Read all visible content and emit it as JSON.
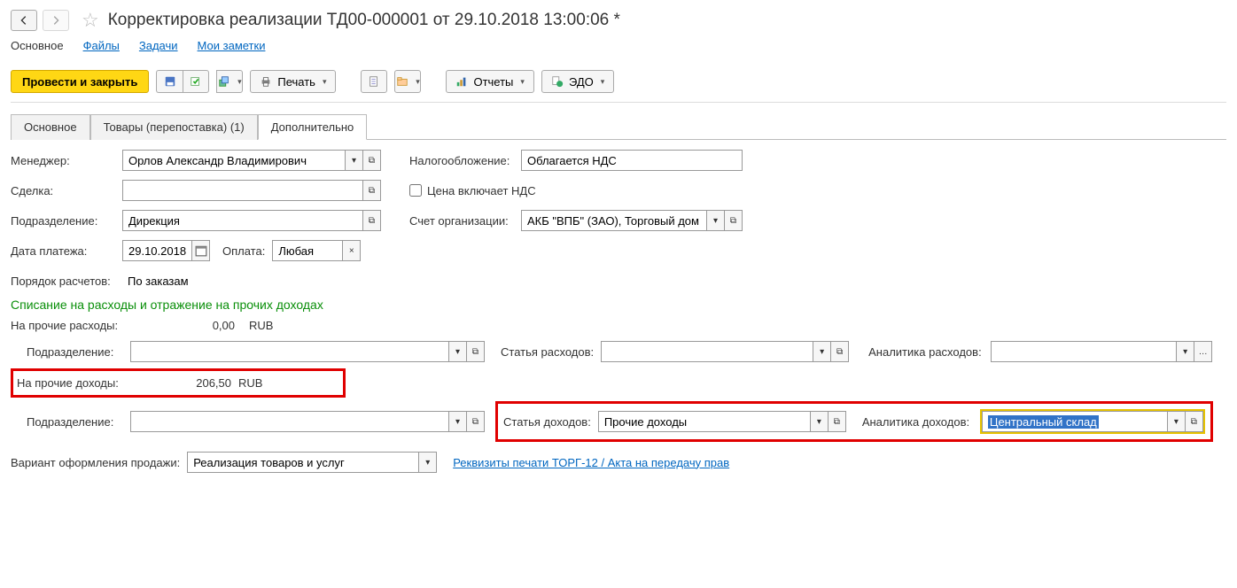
{
  "title": "Корректировка реализации ТД00-000001 от 29.10.2018 13:00:06 *",
  "topnav": {
    "main": "Основное",
    "files": "Файлы",
    "tasks": "Задачи",
    "notes": "Мои заметки"
  },
  "toolbar": {
    "post_close": "Провести и закрыть",
    "print": "Печать",
    "reports": "Отчеты",
    "edo": "ЭДО"
  },
  "tabs": {
    "main": "Основное",
    "goods": "Товары (перепоставка) (1)",
    "extra": "Дополнительно"
  },
  "labels": {
    "manager": "Менеджер:",
    "deal": "Сделка:",
    "dept": "Подразделение:",
    "paydate": "Дата платежа:",
    "payment": "Оплата:",
    "order": "Порядок расчетов:",
    "tax": "Налогообложение:",
    "price_inc_vat": "Цена включает НДС",
    "org_account": "Счет организации:",
    "section": "Списание на расходы и отражение на прочих доходах",
    "other_exp": "На прочие расходы:",
    "sub_dept": "Подразделение:",
    "exp_item": "Статья расходов:",
    "exp_anal": "Аналитика расходов:",
    "other_inc": "На прочие доходы:",
    "inc_item": "Статья доходов:",
    "inc_anal": "Аналитика доходов:",
    "sale_variant": "Вариант оформления продажи:",
    "torg12": "Реквизиты печати ТОРГ-12 / Акта на передачу прав"
  },
  "values": {
    "manager": "Орлов Александр Владимирович",
    "dept": "Дирекция",
    "paydate": "29.10.2018",
    "payment": "Любая",
    "order": "По заказам",
    "tax": "Облагается НДС",
    "org_account": "АКБ \"ВПБ\" (ЗАО), Торговый дом \"К",
    "exp_amount": "0,00",
    "inc_amount": "206,50",
    "currency": "RUB",
    "inc_item": "Прочие доходы",
    "inc_anal": "Центральный склад",
    "sale_variant": "Реализация товаров и услуг"
  }
}
